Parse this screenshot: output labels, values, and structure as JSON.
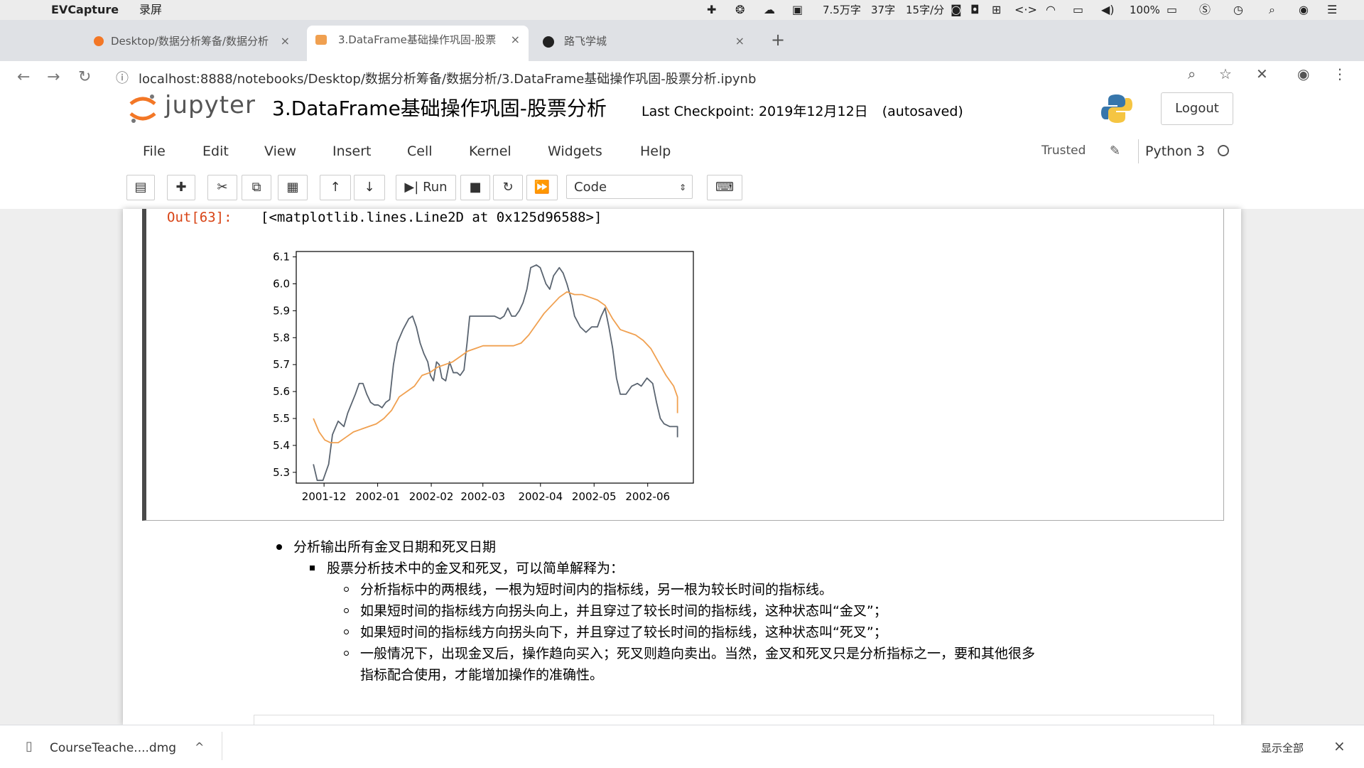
{
  "menubar": {
    "app_name": "EVCapture",
    "record_label": "录屏",
    "stat_words": "7.5万字",
    "stat_chars": "37字",
    "stat_rate": "15字/分",
    "battery": "100%"
  },
  "tabs": [
    {
      "label": "Desktop/数据分析筹备/数据分析",
      "close": "×"
    },
    {
      "label": "3.DataFrame基础操作巩固-股票",
      "close": "×"
    },
    {
      "label": "路飞学城",
      "close": "×"
    }
  ],
  "new_tab": "+",
  "address": {
    "url": "localhost:8888/notebooks/Desktop/数据分析筹备/数据分析/3.DataFrame基础操作巩固-股票分析.ipynb"
  },
  "jupyter": {
    "logo_text": "jupyter",
    "notebook_title": "3.DataFrame基础操作巩固-股票分析",
    "checkpoint": "Last Checkpoint: 2019年12月12日",
    "autosaved": "(autosaved)",
    "logout": "Logout",
    "menus": [
      "File",
      "Edit",
      "View",
      "Insert",
      "Cell",
      "Kernel",
      "Widgets",
      "Help"
    ],
    "trusted": "Trusted",
    "kernel": "Python 3",
    "run_label": "Run",
    "cell_type": "Code"
  },
  "output": {
    "prompt": "Out[63]:",
    "text": "[<matplotlib.lines.Line2D at 0x125d96588>]"
  },
  "chart_data": {
    "type": "line",
    "x_ticks": [
      "2001-12",
      "2002-01",
      "2002-02",
      "2002-03",
      "2002-04",
      "2002-05",
      "2002-06"
    ],
    "y_ticks": [
      "5.3",
      "5.4",
      "5.5",
      "5.6",
      "5.7",
      "5.8",
      "5.9",
      "6.0",
      "6.1"
    ],
    "ylim": [
      5.26,
      6.12
    ],
    "xlim": [
      0,
      1
    ],
    "grid": false,
    "series": [
      {
        "color": "#5a6470",
        "points": [
          [
            0.045,
            5.33
          ],
          [
            0.055,
            5.27
          ],
          [
            0.07,
            5.27
          ],
          [
            0.085,
            5.33
          ],
          [
            0.095,
            5.44
          ],
          [
            0.11,
            5.49
          ],
          [
            0.125,
            5.47
          ],
          [
            0.135,
            5.52
          ],
          [
            0.155,
            5.59
          ],
          [
            0.165,
            5.63
          ],
          [
            0.175,
            5.63
          ],
          [
            0.185,
            5.59
          ],
          [
            0.195,
            5.56
          ],
          [
            0.205,
            5.55
          ],
          [
            0.215,
            5.55
          ],
          [
            0.225,
            5.54
          ],
          [
            0.235,
            5.56
          ],
          [
            0.245,
            5.57
          ],
          [
            0.255,
            5.7
          ],
          [
            0.265,
            5.78
          ],
          [
            0.28,
            5.83
          ],
          [
            0.295,
            5.87
          ],
          [
            0.305,
            5.88
          ],
          [
            0.315,
            5.84
          ],
          [
            0.325,
            5.78
          ],
          [
            0.335,
            5.74
          ],
          [
            0.345,
            5.71
          ],
          [
            0.352,
            5.66
          ],
          [
            0.36,
            5.64
          ],
          [
            0.368,
            5.71
          ],
          [
            0.375,
            5.7
          ],
          [
            0.382,
            5.65
          ],
          [
            0.392,
            5.64
          ],
          [
            0.402,
            5.71
          ],
          [
            0.412,
            5.67
          ],
          [
            0.422,
            5.67
          ],
          [
            0.43,
            5.66
          ],
          [
            0.44,
            5.68
          ],
          [
            0.448,
            5.78
          ],
          [
            0.455,
            5.88
          ],
          [
            0.47,
            5.88
          ],
          [
            0.485,
            5.88
          ],
          [
            0.52,
            5.88
          ],
          [
            0.535,
            5.87
          ],
          [
            0.545,
            5.88
          ],
          [
            0.555,
            5.91
          ],
          [
            0.565,
            5.88
          ],
          [
            0.575,
            5.88
          ],
          [
            0.585,
            5.9
          ],
          [
            0.595,
            5.93
          ],
          [
            0.605,
            5.98
          ],
          [
            0.615,
            6.06
          ],
          [
            0.63,
            6.07
          ],
          [
            0.64,
            6.06
          ],
          [
            0.645,
            6.04
          ],
          [
            0.655,
            6.0
          ],
          [
            0.665,
            5.98
          ],
          [
            0.675,
            6.03
          ],
          [
            0.69,
            6.06
          ],
          [
            0.7,
            6.04
          ],
          [
            0.71,
            6.0
          ],
          [
            0.72,
            5.95
          ],
          [
            0.73,
            5.88
          ],
          [
            0.745,
            5.84
          ],
          [
            0.76,
            5.82
          ],
          [
            0.775,
            5.84
          ],
          [
            0.79,
            5.84
          ],
          [
            0.8,
            5.88
          ],
          [
            0.81,
            5.91
          ],
          [
            0.82,
            5.84
          ],
          [
            0.83,
            5.76
          ],
          [
            0.84,
            5.65
          ],
          [
            0.85,
            5.59
          ],
          [
            0.865,
            5.59
          ],
          [
            0.88,
            5.62
          ],
          [
            0.895,
            5.63
          ],
          [
            0.905,
            5.62
          ],
          [
            0.92,
            5.65
          ],
          [
            0.935,
            5.63
          ],
          [
            0.945,
            5.56
          ],
          [
            0.955,
            5.5
          ],
          [
            0.965,
            5.48
          ],
          [
            0.98,
            5.47
          ],
          [
            0.99,
            5.47
          ],
          [
            1.0,
            5.47
          ],
          [
            1.01,
            5.45
          ],
          [
            1.02,
            5.46
          ],
          [
            1.03,
            5.44
          ],
          [
            1.04,
            5.43
          ]
        ]
      },
      {
        "color": "#f0a050",
        "points": [
          [
            0.045,
            5.5
          ],
          [
            0.06,
            5.45
          ],
          [
            0.075,
            5.42
          ],
          [
            0.09,
            5.41
          ],
          [
            0.11,
            5.41
          ],
          [
            0.13,
            5.43
          ],
          [
            0.15,
            5.45
          ],
          [
            0.17,
            5.46
          ],
          [
            0.19,
            5.47
          ],
          [
            0.21,
            5.48
          ],
          [
            0.23,
            5.5
          ],
          [
            0.25,
            5.53
          ],
          [
            0.27,
            5.58
          ],
          [
            0.29,
            5.6
          ],
          [
            0.31,
            5.62
          ],
          [
            0.33,
            5.66
          ],
          [
            0.35,
            5.67
          ],
          [
            0.37,
            5.69
          ],
          [
            0.39,
            5.7
          ],
          [
            0.41,
            5.71
          ],
          [
            0.43,
            5.73
          ],
          [
            0.45,
            5.75
          ],
          [
            0.47,
            5.76
          ],
          [
            0.49,
            5.77
          ],
          [
            0.51,
            5.77
          ],
          [
            0.53,
            5.77
          ],
          [
            0.55,
            5.77
          ],
          [
            0.57,
            5.77
          ],
          [
            0.59,
            5.78
          ],
          [
            0.61,
            5.81
          ],
          [
            0.63,
            5.85
          ],
          [
            0.65,
            5.89
          ],
          [
            0.67,
            5.92
          ],
          [
            0.69,
            5.95
          ],
          [
            0.71,
            5.97
          ],
          [
            0.73,
            5.96
          ],
          [
            0.75,
            5.96
          ],
          [
            0.77,
            5.95
          ],
          [
            0.79,
            5.94
          ],
          [
            0.81,
            5.92
          ],
          [
            0.83,
            5.87
          ],
          [
            0.85,
            5.83
          ],
          [
            0.87,
            5.82
          ],
          [
            0.89,
            5.81
          ],
          [
            0.91,
            5.79
          ],
          [
            0.93,
            5.76
          ],
          [
            0.95,
            5.71
          ],
          [
            0.97,
            5.66
          ],
          [
            0.99,
            5.62
          ],
          [
            1.01,
            5.58
          ],
          [
            1.03,
            5.54
          ],
          [
            1.04,
            5.52
          ]
        ]
      }
    ]
  },
  "markdown": {
    "l1": "分析输出所有金叉日期和死叉日期",
    "l2": "股票分析技术中的金叉和死叉，可以简单解释为：",
    "l3a": "分析指标中的两根线，一根为短时间内的指标线，另一根为较长时间的指标线。",
    "l3b": "如果短时间的指标线方向拐头向上，并且穿过了较长时间的指标线，这种状态叫“金叉”；",
    "l3c": "如果短时间的指标线方向拐头向下，并且穿过了较长时间的指标线，这种状态叫“死叉”；",
    "l3d1": "一般情况下，出现金叉后，操作趋向买入；死叉则趋向卖出。当然，金叉和死叉只是分析指标之一，要和其他很多",
    "l3d2": "指标配合使用，才能增加操作的准确性。"
  },
  "download": {
    "filename": "CourseTeache....dmg",
    "show_all": "显示全部",
    "close": "×"
  }
}
